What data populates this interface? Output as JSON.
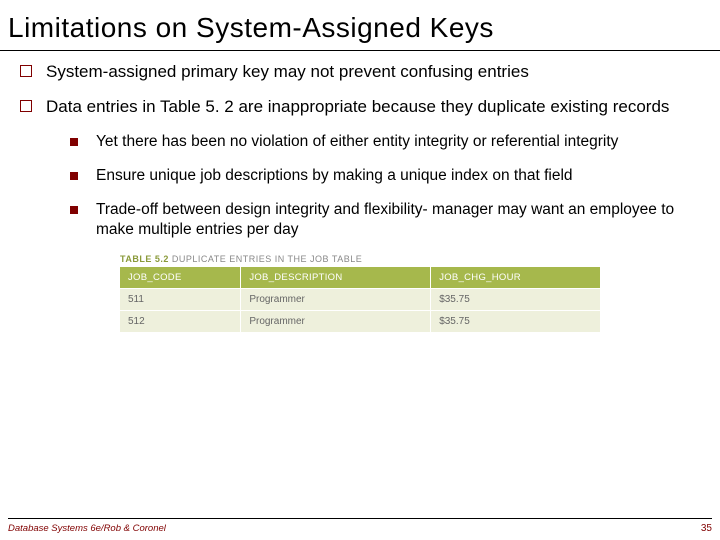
{
  "title": "Limitations on System-Assigned Keys",
  "bullets": [
    "System-assigned primary key may not prevent confusing entries",
    "Data entries in Table 5. 2 are inappropriate because they duplicate existing records"
  ],
  "subbullets": [
    "Yet there has been no violation of either entity integrity or referential integrity",
    "Ensure unique job descriptions by making a unique index on that field",
    "Trade-off between design integrity and flexibility- manager may want an employee to make multiple entries per day"
  ],
  "table": {
    "caption_label": "TABLE 5.2",
    "caption_text": "DUPLICATE ENTRIES IN THE JOB TABLE",
    "headers": [
      "JOB_CODE",
      "JOB_DESCRIPTION",
      "JOB_CHG_HOUR"
    ],
    "rows": [
      [
        "511",
        "Programmer",
        "$35.75"
      ],
      [
        "512",
        "Programmer",
        "$35.75"
      ]
    ]
  },
  "footer_left": "Database Systems 6e/Rob & Coronel",
  "footer_right": "35"
}
